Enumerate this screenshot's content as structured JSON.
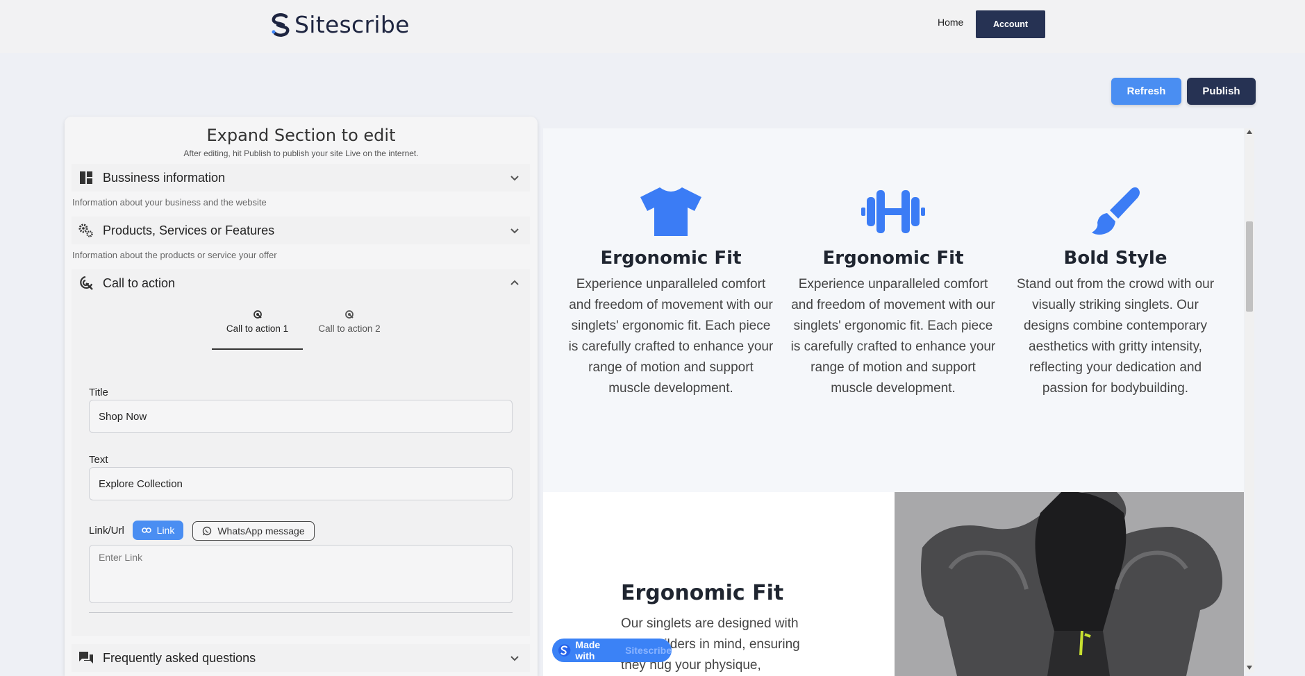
{
  "app": {
    "brand": "Sitescribe"
  },
  "nav": {
    "home": "Home",
    "account": "Account"
  },
  "actions": {
    "refresh": "Refresh",
    "publish": "Publish"
  },
  "editor": {
    "title": "Expand Section to edit",
    "subtitle": "After editing, hit Publish to publish your site Live on the internet.",
    "sections": [
      {
        "label": "Bussiness information",
        "desc": "Information about your business and the website",
        "icon": "dashboard-icon"
      },
      {
        "label": "Products, Services or Features",
        "desc": "Information about the products or service your offer",
        "icon": "gears-icon"
      },
      {
        "label": "Call to action",
        "icon": "click-target-icon"
      },
      {
        "label": "Frequently asked questions",
        "icon": "chat-bubbles-icon"
      }
    ],
    "cta": {
      "tabs": [
        "Call to action 1",
        "Call to action 2"
      ],
      "title_label": "Title",
      "title_value": "Shop Now",
      "text_label": "Text",
      "text_value": "Explore Collection",
      "link_label": "Link/Url",
      "link_chip": "Link",
      "whatsapp_chip": "WhatsApp message",
      "link_placeholder": "Enter Link"
    }
  },
  "preview": {
    "features": [
      {
        "title": "Ergonomic Fit",
        "text": "Experience unparalleled comfort and freedom of movement with our singlets' ergonomic fit. Each piece is carefully crafted to enhance your range of motion and support muscle development.",
        "icon": "tshirt-icon"
      },
      {
        "title": "Ergonomic Fit",
        "text": "Experience unparalleled comfort and freedom of movement with our singlets' ergonomic fit. Each piece is carefully crafted to enhance your range of motion and support muscle development.",
        "icon": "dumbbell-icon"
      },
      {
        "title": "Bold Style",
        "text": "Stand out from the crowd with our visually striking singlets. Our designs combine contemporary aesthetics with gritty intensity, reflecting your dedication and passion for bodybuilding.",
        "icon": "paintbrush-icon"
      }
    ],
    "lower": {
      "title": "Ergonomic Fit",
      "text": "Our singlets are designed with bodybuilders in mind, ensuring they hug your physique,"
    },
    "badge": {
      "prefix": "Made with",
      "brand": "Sitescribe"
    }
  },
  "colors": {
    "accent": "#4a8ef2",
    "navy": "#263253",
    "icon_blue": "#3b7cf5"
  }
}
